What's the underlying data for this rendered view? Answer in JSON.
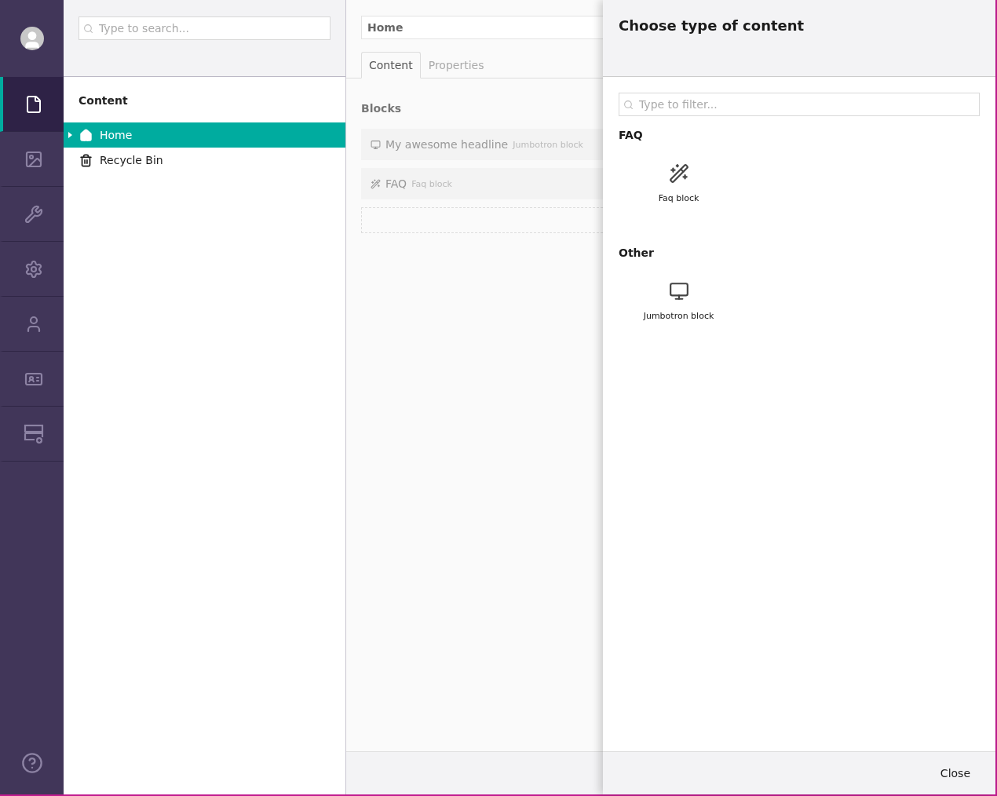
{
  "nav": {
    "sections": [
      {
        "selected": true
      },
      {
        "selected": false
      },
      {
        "selected": false
      },
      {
        "selected": false
      },
      {
        "selected": false
      },
      {
        "selected": false
      },
      {
        "selected": false
      }
    ]
  },
  "tree": {
    "search": {
      "placeholder": "Type to search..."
    },
    "heading": "Content",
    "items": [
      {
        "label": "Home",
        "selected": true,
        "expandable": true
      },
      {
        "label": "Recycle Bin",
        "selected": false,
        "expandable": false
      }
    ]
  },
  "editor": {
    "name": "Home",
    "tabs": [
      {
        "label": "Content",
        "selected": true
      },
      {
        "label": "Properties",
        "selected": false
      }
    ],
    "group": "Blocks",
    "blocks": [
      {
        "title": "My awesome headline",
        "type": "Jumbotron block"
      },
      {
        "title": "FAQ",
        "type": "Faq block"
      }
    ]
  },
  "dialog": {
    "title": "Choose type of content",
    "filter": {
      "placeholder": "Type to filter..."
    },
    "groups": [
      {
        "name": "FAQ",
        "items": [
          "Faq block"
        ]
      },
      {
        "name": "Other",
        "items": [
          "Jumbotron block"
        ]
      }
    ],
    "close": "Close"
  }
}
